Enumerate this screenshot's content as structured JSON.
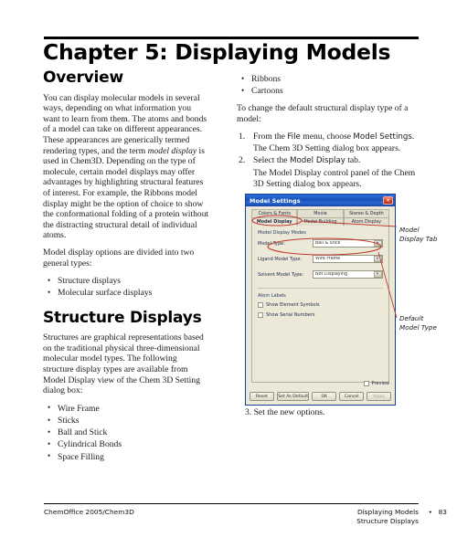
{
  "document": {
    "chapter_title": "Chapter 5: Displaying Models"
  },
  "left_column": {
    "overview_heading": "Overview",
    "overview_paragraph_1_a": "You can display molecular models in several ways, depending on what information you want to learn from them. The atoms and bonds of a model can take on different appearances. These appearances are generically termed rendering types, and the term ",
    "overview_paragraph_1_italic": "model display",
    "overview_paragraph_1_b": " is used in Chem3D. Depending on the type of molecule, certain model displays may offer advantages by highlighting structural features of interest. For example, the Ribbons model display might be the option of choice to show the conformational folding of a protein without the distracting structural detail of individual atoms.",
    "overview_paragraph_2": "Model display options are divided into two general types:",
    "overview_bullets": [
      "Structure displays",
      "Molecular surface displays"
    ],
    "structure_heading": "Structure Displays",
    "structure_paragraph": "Structures are graphical representations based on the traditional physical three-dimensional molecular model types. The following structure display types are available from Model Display view of the Chem 3D Setting dialog box:",
    "structure_bullets": [
      "Wire Frame",
      "Sticks",
      "Ball and Stick",
      "Cylindrical Bonds",
      "Space Filling"
    ]
  },
  "right_column": {
    "top_bullets": [
      "Ribbons",
      "Cartoons"
    ],
    "intro_paragraph": "To change the default structural display type of a model:",
    "steps": [
      {
        "number": "1.",
        "text_a": "From the ",
        "emphasis_1": "File",
        "text_b": " menu, choose ",
        "emphasis_2": "Model Settings",
        "text_c": ".",
        "sub": "The Chem 3D Setting dialog box appears."
      },
      {
        "number": "2.",
        "text_a": "Select the ",
        "emphasis_1": "Model Display",
        "text_b": " tab.",
        "emphasis_2": "",
        "text_c": "",
        "sub": "The Model Display control panel of the Chem 3D Setting dialog box appears."
      }
    ],
    "step3": "3. Set the new options."
  },
  "dialog": {
    "title": "Model Settings",
    "close_glyph": "✕",
    "tabs_row1": [
      "Colors & Fonts",
      "Movie",
      "Stereo & Depth"
    ],
    "tabs_row2": [
      "Model Display",
      "Model Building",
      "Atom Display"
    ],
    "active_tab": "Model Display",
    "group_label": "Model Display Modes",
    "fields": [
      {
        "label": "Model Type:",
        "value": "Ball & Stick"
      },
      {
        "label": "Ligand Model Type:",
        "value": "Wire Frame"
      },
      {
        "label": "Solvent Model Type:",
        "value": "Not Displaying"
      }
    ],
    "atom_labels_group": "Atom Labels",
    "checkboxes": [
      {
        "label": "Show Element Symbols",
        "checked": false
      },
      {
        "label": "Show Serial Numbers",
        "checked": false
      }
    ],
    "preview_label": "Preview",
    "buttons": [
      {
        "label": "Reset",
        "enabled": true
      },
      {
        "label": "Set As Default",
        "enabled": true
      },
      {
        "label": "OK",
        "enabled": true
      },
      {
        "label": "Cancel",
        "enabled": true
      },
      {
        "label": "Apply",
        "enabled": false
      }
    ]
  },
  "annotations": {
    "model_display_tab": "Model Display Tab",
    "default_model_type": "Default Model Type",
    "accent_color": "#c0392b"
  },
  "footer": {
    "left": "ChemOffice 2005/Chem3D",
    "right_line1": "Displaying Models",
    "right_line2": "Structure Displays",
    "bullet": "•",
    "page_number": "83"
  }
}
